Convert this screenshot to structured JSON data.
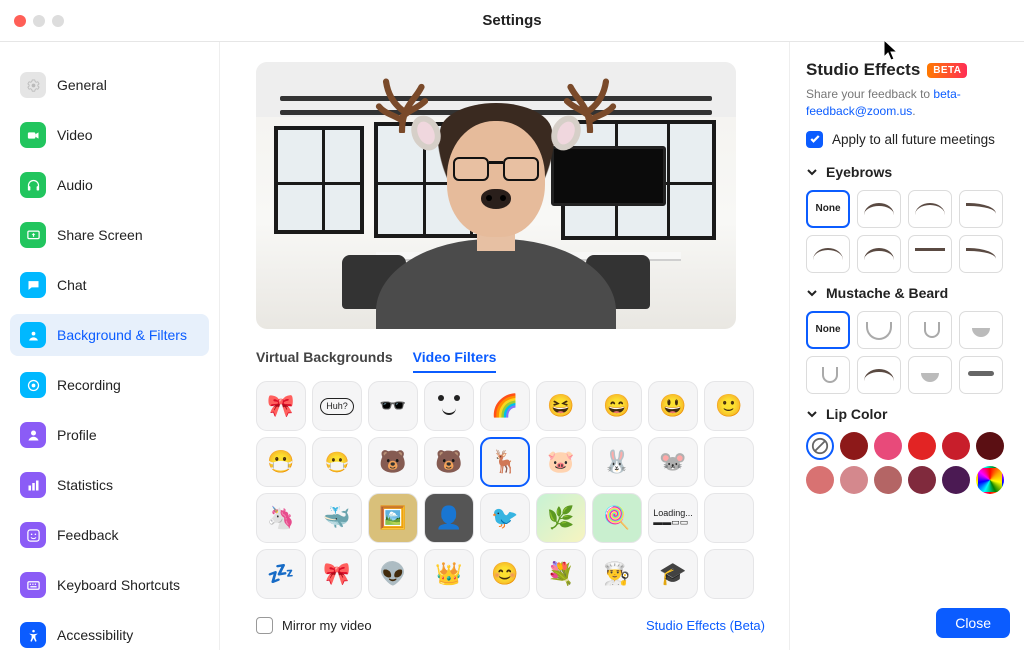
{
  "window_title": "Settings",
  "sidebar": {
    "items": [
      {
        "label": "General"
      },
      {
        "label": "Video"
      },
      {
        "label": "Audio"
      },
      {
        "label": "Share Screen"
      },
      {
        "label": "Chat"
      },
      {
        "label": "Background & Filters"
      },
      {
        "label": "Recording"
      },
      {
        "label": "Profile"
      },
      {
        "label": "Statistics"
      },
      {
        "label": "Feedback"
      },
      {
        "label": "Keyboard Shortcuts"
      },
      {
        "label": "Accessibility"
      }
    ],
    "active_index": 5
  },
  "center": {
    "tabs": {
      "virtual_backgrounds": "Virtual Backgrounds",
      "video_filters": "Video Filters"
    },
    "active_tab": "video_filters",
    "filters_selected_index": 13,
    "mirror_label": "Mirror my video",
    "mirror_checked": false,
    "studio_link": "Studio Effects (Beta)",
    "filter_names": [
      "bow",
      "huh",
      "sunglasses",
      "face-blush",
      "rainbow-brow",
      "face-wink",
      "face-laugh",
      "face-smile",
      "face-neutral",
      "mask",
      "surgical-mask",
      "bear",
      "bear-brown",
      "reindeer",
      "pig",
      "bunny",
      "mouse",
      "space",
      "unicorn",
      "narwhal",
      "picture-frame",
      "dark-frame",
      "bird",
      "sparkle",
      "lollipops",
      "loading",
      "sleepy",
      "red-bow",
      "antenna",
      "gold-crown",
      "flower-crown",
      "blue-flower",
      "chef-hat",
      "grad-cap",
      "extra"
    ]
  },
  "right": {
    "title": "Studio Effects",
    "beta_label": "BETA",
    "feedback_prefix": "Share your feedback to ",
    "feedback_link": "beta-feedback@zoom.us",
    "apply_label": "Apply to all future meetings",
    "apply_checked": true,
    "sections": {
      "eyebrows": {
        "title": "Eyebrows",
        "none_label": "None",
        "selected_index": 0,
        "option_count": 8
      },
      "mustache_beard": {
        "title": "Mustache & Beard",
        "none_label": "None",
        "selected_index": 0,
        "option_count": 8
      },
      "lip_color": {
        "title": "Lip Color",
        "selected_index": 0,
        "colors": [
          "none",
          "#8d1919",
          "#e84a7a",
          "#e22424",
          "#c81e2b",
          "#5b0f13",
          "#d87272",
          "#d4888d",
          "#b46565",
          "#802a3d",
          "#4b1a53",
          "rainbow"
        ]
      }
    },
    "close_label": "Close"
  }
}
